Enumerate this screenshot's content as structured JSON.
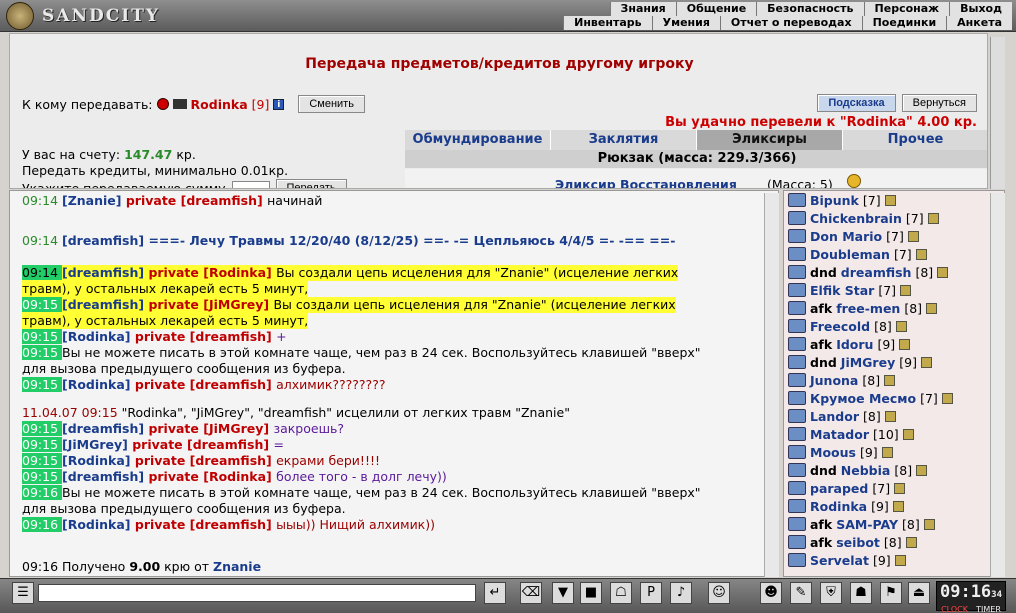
{
  "app": {
    "brand": "SANDCITY"
  },
  "menu_top": [
    "Знания",
    "Общение",
    "Безопасность",
    "Персонаж",
    "Выход"
  ],
  "menu_bottom": [
    "Инвентарь",
    "Умения",
    "Отчет о переводах",
    "Поединки",
    "Анкета"
  ],
  "panel": {
    "title": "Передача предметов/кредитов другому игроку",
    "to_label": "К кому передавать:",
    "recipient": "Rodinka",
    "recipient_level": "[9]",
    "change_btn": "Сменить",
    "hint_btn": "Подсказка",
    "back_btn": "Вернуться",
    "success": "Вы удачно перевели к \"Rodinka\" 4.00 кр.",
    "balance_label": "У вас на счету:",
    "balance_value": "147.47",
    "balance_unit": "кр.",
    "min_note": "Передать кредиты, минимально 0.01кр.",
    "amount_label": "Укажите передаваемую сумму",
    "send_btn": "Передать",
    "tabs": [
      "Обмундирование",
      "Заклятия",
      "Эликсиры",
      "Прочее"
    ],
    "active_tab": "Эликсиры",
    "backpack": "Рюкзак (масса: 229.3/366)",
    "item_name": "Эликсир Восстановления",
    "item_mass": "(Масса: 5)"
  },
  "chat": [
    {
      "time": "09:14",
      "parts": [
        {
          "c": "blue",
          "t": "[Znanie]"
        },
        {
          "c": "priv",
          "t": " private [dreamfish] "
        },
        {
          "c": "",
          "t": "начинай"
        }
      ]
    },
    {
      "time": "09:14",
      "parts": [
        {
          "c": "blue",
          "t": "[dreamfish]"
        },
        {
          "c": "blue",
          "t": "       ===- Лечу Травмы 12/20/40 (8/12/25) ==- -= Цепльяюсь 4/4/5 =-        -== ==-"
        }
      ]
    },
    {
      "time": "09:14",
      "parts": [
        {
          "c": "blue",
          "t": "[dreamfish]"
        },
        {
          "c": "priv",
          "t": " private [Rodinka] "
        },
        {
          "c": "",
          "t": "Вы создали цепь исцеления для \"Znanie\" (исцеление легких"
        }
      ],
      "yel": true
    },
    {
      "time": "",
      "parts": [
        {
          "c": "",
          "t": "травм), у остальных лекарей есть 5 минут,"
        }
      ],
      "yel": true
    },
    {
      "time": "09:15",
      "parts": [
        {
          "c": "blue",
          "t": "[dreamfish]"
        },
        {
          "c": "priv",
          "t": " private [JiMGrey] "
        },
        {
          "c": "",
          "t": "Вы создали цепь исцеления для \"Znanie\" (исцеление легких"
        }
      ],
      "yel": true
    },
    {
      "time": "",
      "parts": [
        {
          "c": "",
          "t": "травм), у остальных лекарей есть 5 минут,"
        }
      ],
      "yel": true
    },
    {
      "time": "09:15",
      "parts": [
        {
          "c": "blue",
          "t": "[Rodinka]"
        },
        {
          "c": "priv",
          "t": " private [dreamfish] "
        },
        {
          "c": "purple",
          "t": "+"
        }
      ]
    },
    {
      "time": "09:15",
      "parts": [
        {
          "c": "",
          "t": "Вы не можете писать в этой комнате чаще, чем раз в 24 сек. Воспользуйтесь клавишей \"вверх\""
        }
      ]
    },
    {
      "time": "",
      "parts": [
        {
          "c": "",
          "t": "для вызова предыдущего сообщения из буфера."
        }
      ]
    },
    {
      "time": "09:15",
      "parts": [
        {
          "c": "blue",
          "t": "[Rodinka]"
        },
        {
          "c": "priv",
          "t": " private [dreamfish] "
        },
        {
          "c": "dred",
          "t": "алхимик????????"
        }
      ]
    },
    {
      "time": "11.04.07 09:15",
      "parts": [
        {
          "c": "",
          "t": "       \"Rodinka\", \"JiMGrey\", \"dreamfish\" исцелили от легких травм \"Znanie\""
        }
      ],
      "sys": true
    },
    {
      "time": "09:15",
      "parts": [
        {
          "c": "blue",
          "t": "[dreamfish]"
        },
        {
          "c": "priv",
          "t": " private [JiMGrey] "
        },
        {
          "c": "purple",
          "t": "закроешь?"
        }
      ]
    },
    {
      "time": "09:15",
      "parts": [
        {
          "c": "blue",
          "t": "[JiMGrey]"
        },
        {
          "c": "priv",
          "t": " private [dreamfish] "
        },
        {
          "c": "purple",
          "t": "="
        }
      ]
    },
    {
      "time": "09:15",
      "parts": [
        {
          "c": "blue",
          "t": "[Rodinka]"
        },
        {
          "c": "priv",
          "t": " private [dreamfish] "
        },
        {
          "c": "dred",
          "t": "екрами бери!!!!"
        }
      ]
    },
    {
      "time": "09:15",
      "parts": [
        {
          "c": "blue",
          "t": "[dreamfish]"
        },
        {
          "c": "priv",
          "t": " private [Rodinka] "
        },
        {
          "c": "purple",
          "t": "более того - в долг лечу))"
        }
      ]
    },
    {
      "time": "09:16",
      "parts": [
        {
          "c": "",
          "t": "Вы не можете писать в этой комнате чаще, чем раз в 24 сек. Воспользуйтесь клавишей \"вверх\""
        }
      ]
    },
    {
      "time": "",
      "parts": [
        {
          "c": "",
          "t": "для вызова предыдущего сообщения из буфера."
        }
      ]
    },
    {
      "time": "09:16",
      "parts": [
        {
          "c": "blue",
          "t": "[Rodinka]"
        },
        {
          "c": "priv",
          "t": " private [dreamfish] "
        },
        {
          "c": "dred",
          "t": "ыыы)) Нищий алхимик))"
        }
      ]
    },
    {
      "time": "09:16",
      "parts": [
        {
          "c": "",
          "t": "             Получено "
        },
        {
          "c": "bold",
          "t": "9.00"
        },
        {
          "c": "",
          "t": " крю от "
        },
        {
          "c": "blue",
          "t": "Znanie"
        }
      ]
    }
  ],
  "users": [
    {
      "afk": "",
      "name": "Bipunk",
      "lvl": "[7]"
    },
    {
      "afk": "",
      "name": "Chickenbrain",
      "lvl": "[7]"
    },
    {
      "afk": "",
      "name": "Don Mario",
      "lvl": "[7]"
    },
    {
      "afk": "",
      "name": "Doubleman",
      "lvl": "[7]"
    },
    {
      "afk": "dnd",
      "name": "dreamfish",
      "lvl": "[8]"
    },
    {
      "afk": "",
      "name": "Elfik Star",
      "lvl": "[7]"
    },
    {
      "afk": "afk",
      "name": "free-men",
      "lvl": "[8]"
    },
    {
      "afk": "",
      "name": "Freecold",
      "lvl": "[8]"
    },
    {
      "afk": "afk",
      "name": "Idoru",
      "lvl": "[9]"
    },
    {
      "afk": "dnd",
      "name": "JiMGrey",
      "lvl": "[9]"
    },
    {
      "afk": "",
      "name": "Junona",
      "lvl": "[8]"
    },
    {
      "afk": "",
      "name": "Крумое Месмо",
      "lvl": "[7]"
    },
    {
      "afk": "",
      "name": "Landor",
      "lvl": "[8]"
    },
    {
      "afk": "",
      "name": "Matador",
      "lvl": "[10]"
    },
    {
      "afk": "",
      "name": "Moous",
      "lvl": "[9]"
    },
    {
      "afk": "dnd",
      "name": "Nebbia",
      "lvl": "[8]"
    },
    {
      "afk": "",
      "name": "paraped",
      "lvl": "[7]"
    },
    {
      "afk": "",
      "name": "Rodinka",
      "lvl": "[9]"
    },
    {
      "afk": "afk",
      "name": "SAM-PAY",
      "lvl": "[8]"
    },
    {
      "afk": "afk",
      "name": "seibot",
      "lvl": "[8]"
    },
    {
      "afk": "",
      "name": "Servelat",
      "lvl": "[9]"
    }
  ],
  "clock": {
    "time": "09:16",
    "sec": "34",
    "label_clock": "CLOCK",
    "label_timer": "TIMER"
  },
  "colors": {
    "accent_red": "#c00000",
    "link_blue": "#1a3c8c",
    "ts_green": "#22cc66",
    "highlight_yellow": "#ffff33"
  }
}
